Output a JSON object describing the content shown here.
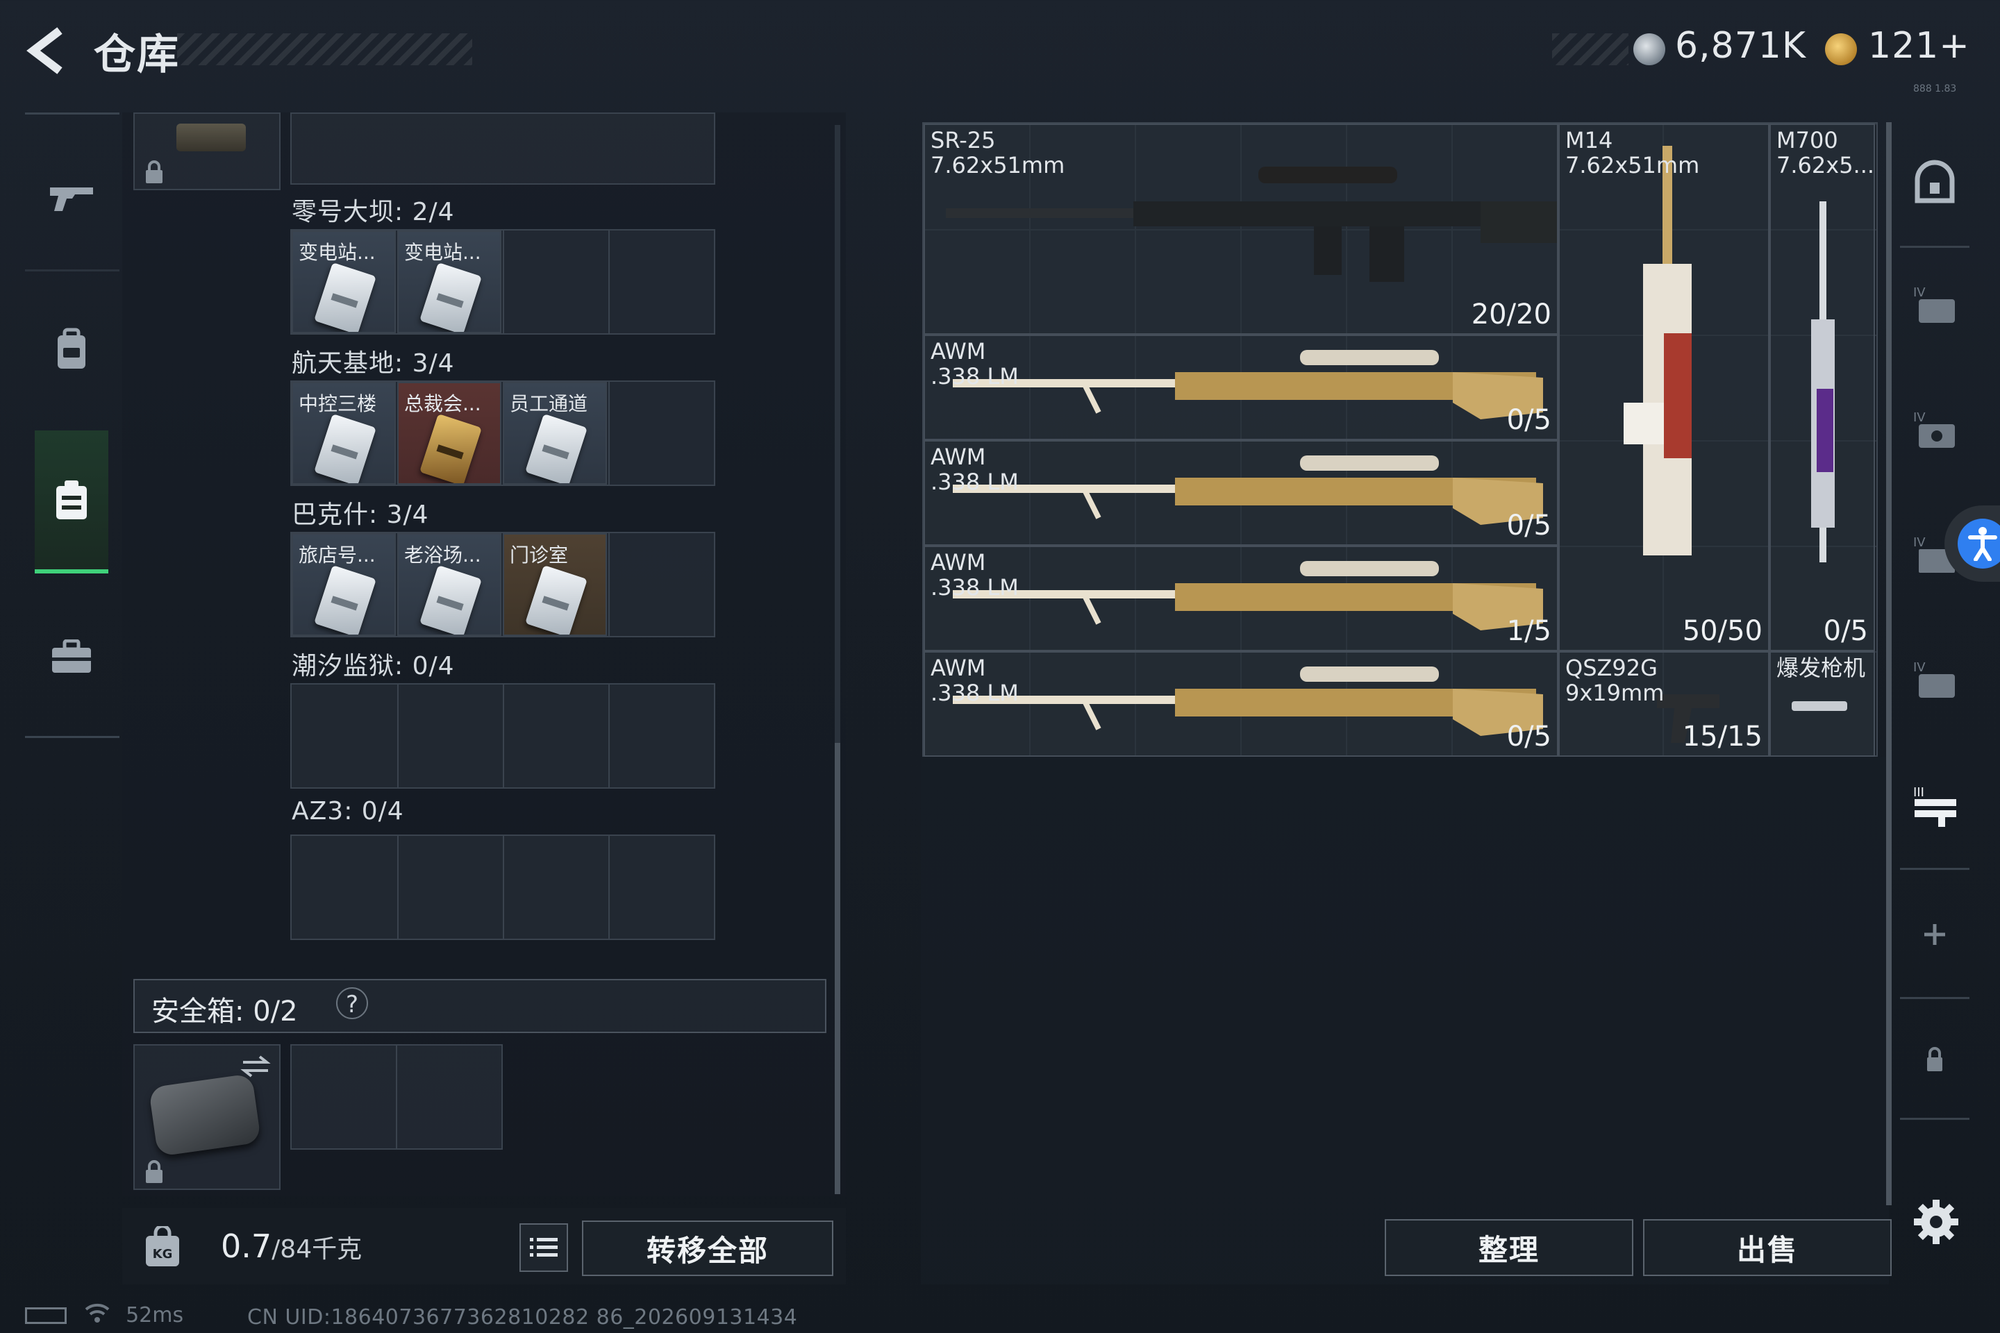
{
  "header": {
    "title": "仓库",
    "currency1": "6,871K",
    "currency2": "121+",
    "version_text": "888 1.83"
  },
  "left_nav": {
    "items": [
      "weapons-icon",
      "backpack-icon",
      "container-icon",
      "toolbox-icon"
    ],
    "active": "container-icon"
  },
  "keycard_groups": [
    {
      "label": "零号大坝: 2/4",
      "cards": [
        {
          "name": "变电站...",
          "rarity": "white"
        },
        {
          "name": "变电站...",
          "rarity": "white"
        }
      ]
    },
    {
      "label": "航天基地: 3/4",
      "cards": [
        {
          "name": "中控三楼",
          "rarity": "white"
        },
        {
          "name": "总裁会...",
          "rarity": "red"
        },
        {
          "name": "员工通道",
          "rarity": "white"
        }
      ]
    },
    {
      "label": "巴克什: 3/4",
      "cards": [
        {
          "name": "旅店号...",
          "rarity": "white"
        },
        {
          "name": "老浴场...",
          "rarity": "white"
        },
        {
          "name": "门诊室",
          "rarity": "gold"
        }
      ]
    },
    {
      "label": "潮汐监狱: 0/4",
      "cards": []
    },
    {
      "label": "AZ3: 0/4",
      "cards": []
    }
  ],
  "safe_box": {
    "label": "安全箱: 0/2",
    "help": "?"
  },
  "footer": {
    "weight_value": "0.7",
    "weight_cap": "/84千克",
    "transfer_all": "转移全部",
    "ping": "52ms",
    "uid": "CN UID:1864073677362810282 86_202609131434"
  },
  "stash_items": [
    {
      "name": "SR-25",
      "ammo": "7.62x51mm",
      "count": "20/20"
    },
    {
      "name": "M14",
      "ammo": "7.62x51mm",
      "count": "50/50"
    },
    {
      "name": "M700",
      "ammo": "7.62x5...",
      "count": "0/5"
    },
    {
      "name": "AWM",
      "ammo": ".338 LM",
      "count": "0/5"
    },
    {
      "name": "AWM",
      "ammo": ".338 LM",
      "count": "0/5"
    },
    {
      "name": "AWM",
      "ammo": ".338 LM",
      "count": "1/5"
    },
    {
      "name": "AWM",
      "ammo": ".338 LM",
      "count": "0/5"
    },
    {
      "name": "QSZ92G",
      "ammo": "9x19mm",
      "count": "15/15"
    },
    {
      "name": "爆发枪机",
      "ammo": "",
      "count": ""
    }
  ],
  "actions": {
    "organize": "整理",
    "sell": "出售"
  },
  "right_nav": {
    "items": [
      "vault-icon",
      "tier4-case-icon",
      "tier4-safe-icon",
      "tier4-crate-icon",
      "tier4-box-icon",
      "tier3-gun-rack-icon",
      "add-icon",
      "lock-icon"
    ]
  }
}
